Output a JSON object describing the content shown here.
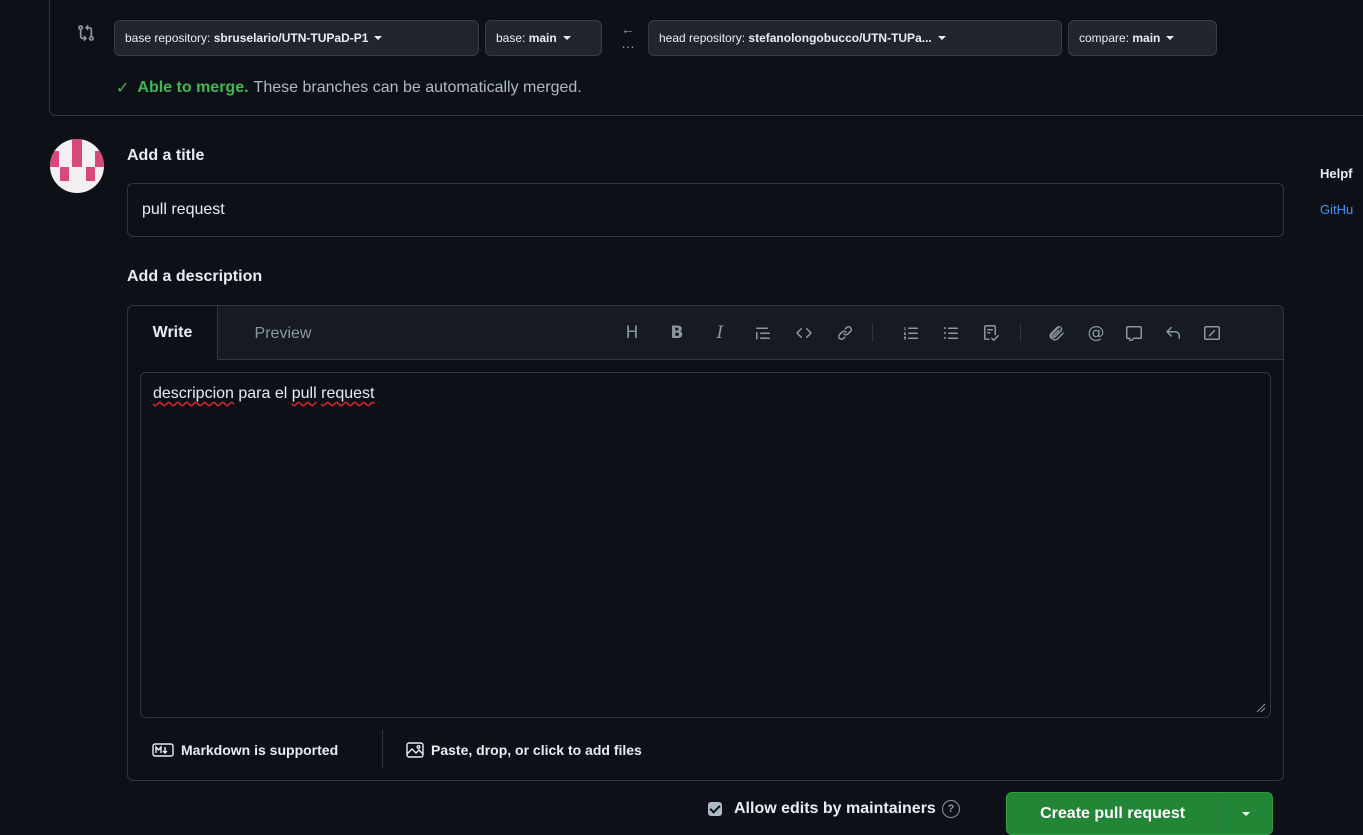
{
  "compare": {
    "base_repo_label": "base repository:",
    "base_repo_value": "sbruselario/UTN-TUPaD-P1",
    "base_label": "base:",
    "base_value": "main",
    "head_repo_label": "head repository:",
    "head_repo_value": "stefanolongobucco/UTN-TUPa...",
    "compare_label": "compare:",
    "compare_value": "main",
    "merge_ok": "Able to merge.",
    "merge_desc": "These branches can be automatically merged."
  },
  "form": {
    "title_heading": "Add a title",
    "title_value": "pull request",
    "description_heading": "Add a description",
    "tabs": {
      "write": "Write",
      "preview": "Preview"
    },
    "description_parts": [
      "descripcion",
      " para el ",
      "pull",
      " ",
      "request"
    ],
    "markdown_note": "Markdown is supported",
    "attach_note": "Paste, drop, or click to add files"
  },
  "toolbar_icons": [
    "heading-icon",
    "bold-icon",
    "italic-icon",
    "quote-icon",
    "code-icon",
    "link-icon",
    "numbered-list-icon",
    "unordered-list-icon",
    "task-list-icon",
    "attach-icon",
    "mention-icon",
    "reference-icon",
    "undo-icon",
    "slash-commands-icon"
  ],
  "actions": {
    "allow_edits": "Allow edits by maintainers",
    "allow_edits_checked": true,
    "create_button": "Create pull request"
  },
  "sidebar": {
    "title": "Helpf",
    "link": "GitHu"
  },
  "colors": {
    "background": "#0d1117",
    "border": "#30363d",
    "success": "#3fb950",
    "button_green": "#238636",
    "link": "#4493f8"
  }
}
